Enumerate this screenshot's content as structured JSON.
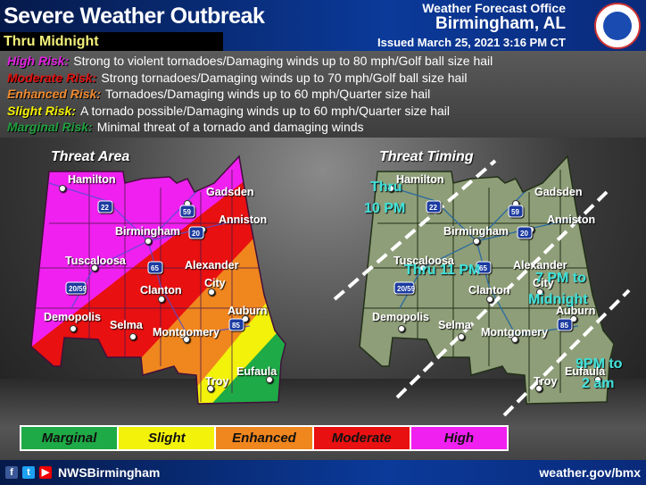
{
  "header": {
    "title": "Severe Weather Outbreak",
    "subtitle": "Thru Midnight",
    "office_line1": "Weather Forecast Office",
    "office_line2": "Birmingham, AL",
    "issued": "Issued March 25, 2021 3:16 PM CT",
    "logo_text": "NATIONAL WEATHER SERVICE"
  },
  "risks": [
    {
      "label": "High Risk:",
      "text": "Strong to violent tornadoes/Damaging winds up to 80 mph/Golf ball size hail",
      "color": "#e020e0"
    },
    {
      "label": "Moderate Risk:",
      "text": "Strong tornadoes/Damaging winds up to 70 mph/Golf ball size hail",
      "color": "#e01010"
    },
    {
      "label": "Enhanced Risk:",
      "text": "Tornadoes/Damaging winds up to 60 mph/Quarter size hail",
      "color": "#f08a30"
    },
    {
      "label": "Slight Risk:",
      "text": "A tornado possible/Damaging winds up to 60 mph/Quarter size hail",
      "color": "#f4f000"
    },
    {
      "label": "Marginal Risk:",
      "text": "Minimal threat of a tornado and damaging winds",
      "color": "#20a040"
    }
  ],
  "maps": {
    "area_title": "Threat Area",
    "timing_title": "Threat Timing",
    "cities": [
      "Hamilton",
      "Gadsden",
      "Anniston",
      "Birmingham",
      "Tuscaloosa",
      "Alexander",
      "City",
      "Clanton",
      "Auburn",
      "Demopolis",
      "Selma",
      "Montgomery",
      "Eufaula",
      "Troy"
    ],
    "interstates": [
      "22",
      "59",
      "20",
      "65",
      "20/59",
      "85"
    ],
    "timing_labels": [
      "Thru",
      "10 PM",
      "Thru 11 PM",
      "7 PM to",
      "Midnight",
      "9PM to",
      "2 am"
    ],
    "colors": {
      "high": "#f020f0",
      "moderate": "#e81010",
      "enhanced": "#f0861e",
      "slight": "#f2f20a",
      "marginal": "#1eaa46",
      "timing_land": "#8e9e78",
      "timing_text": "#40e0d8"
    }
  },
  "legend": [
    {
      "label": "Marginal",
      "color": "#1eaa46"
    },
    {
      "label": "Slight",
      "color": "#f2f20a"
    },
    {
      "label": "Enhanced",
      "color": "#f0861e"
    },
    {
      "label": "Moderate",
      "color": "#e81010"
    },
    {
      "label": "High",
      "color": "#f020f0"
    }
  ],
  "footer": {
    "handle": "NWSBirmingham",
    "url": "weather.gov/bmx",
    "icons": [
      "facebook-icon",
      "twitter-icon",
      "youtube-icon"
    ]
  }
}
